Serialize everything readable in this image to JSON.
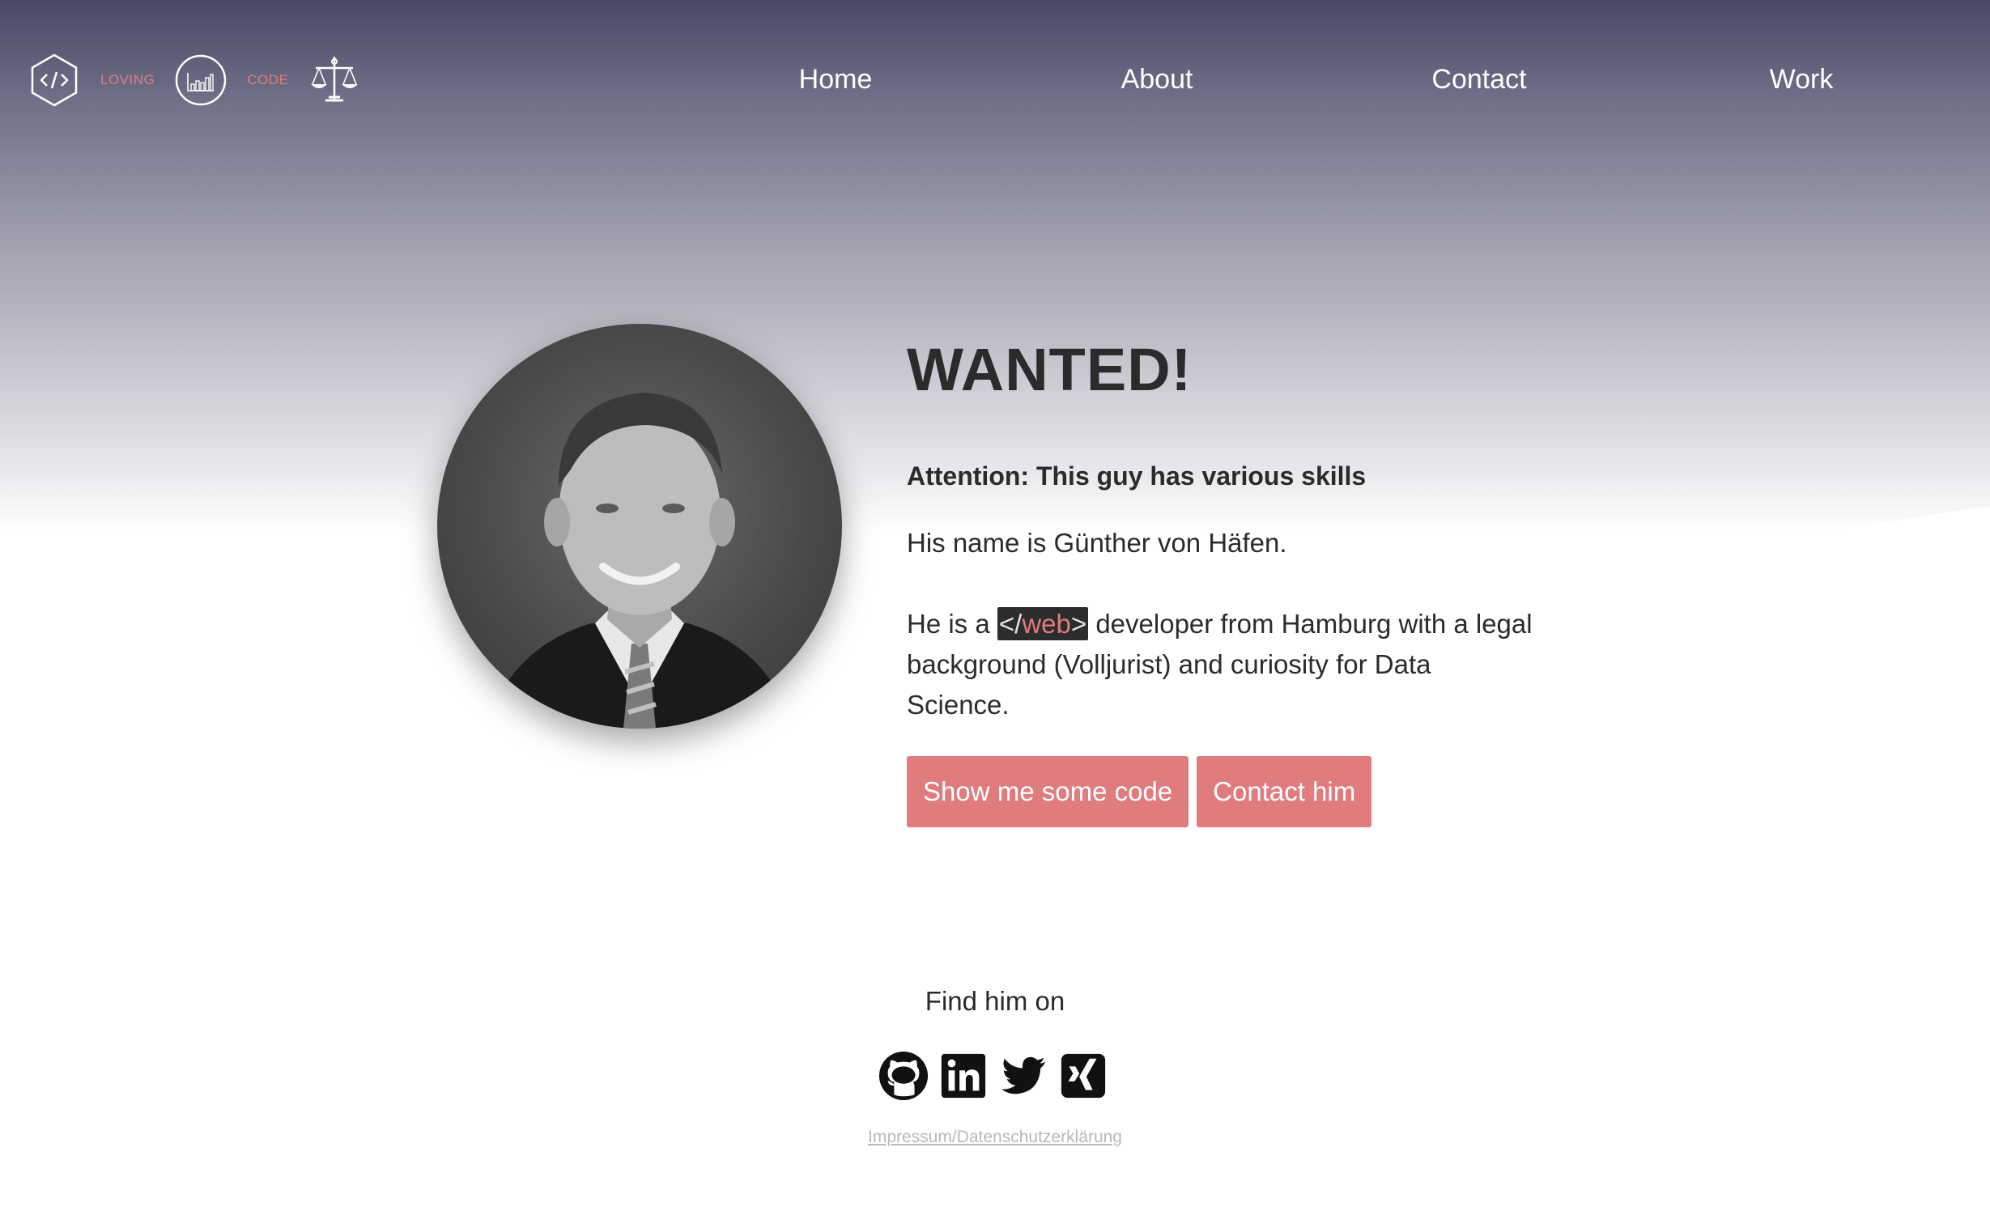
{
  "logo": {
    "words": [
      "LOVING",
      "CODE"
    ],
    "icons": [
      "code-hexagon-icon",
      "bar-chart-circle-icon",
      "scales-of-justice-icon"
    ],
    "accent_color": "#e07b7e"
  },
  "nav": {
    "items": [
      {
        "label": "Home"
      },
      {
        "label": "About"
      },
      {
        "label": "Contact"
      },
      {
        "label": "Work"
      }
    ]
  },
  "hero": {
    "title": "WANTED!",
    "subtitle": "Attention: This guy has various skills",
    "name_line": "His name is Günther von Häfen.",
    "desc_before": "He is a ",
    "web_tag_open": "</",
    "web_tag_word": "web",
    "web_tag_close": ">",
    "desc_after": " developer from Hamburg with a legal background (Volljurist) and curiosity for Data Science.",
    "portrait_alt": "portrait photo",
    "buttons": {
      "code": "Show me some code",
      "contact": "Contact him"
    },
    "button_color": "#e07b7e"
  },
  "footer": {
    "find_label": "Find him on",
    "socials": [
      "github-icon",
      "linkedin-icon",
      "twitter-icon",
      "xing-icon"
    ],
    "impressum": "Impressum/Datenschutzerklärung"
  }
}
